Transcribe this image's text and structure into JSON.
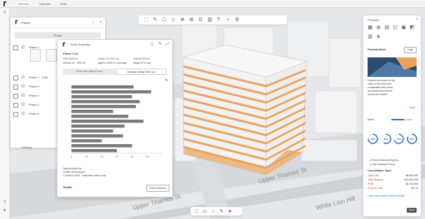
{
  "tabs": [
    {
      "label": "Overview"
    },
    {
      "label": "Calendar"
    },
    {
      "label": "Tools"
    }
  ],
  "phases_panel": {
    "title": "Phases",
    "add_button": "Phase",
    "rows": [
      {
        "label": "Phase 1"
      },
      {
        "label": "Phase 2 · 1948"
      },
      {
        "label": "Phase 3"
      },
      {
        "label": "Phase 4"
      },
      {
        "label": "Phase 5"
      },
      {
        "label": "Phase 6"
      }
    ],
    "settings_label": "Settings"
  },
  "gross_panel": {
    "title": "Gross Summary",
    "subtitle": "Phase 1 (1)",
    "stats_left": [
      "GFA 9,615 m²",
      "Storeys 10 · 83% eff"
    ],
    "stats_mid": [
      "Gross 7 m² 94.7 m²",
      "Approx 6,800 m² coverage"
    ],
    "stats_right": [
      "Volume 44.6 m³",
      "Height 32 m avg"
    ],
    "segment_left": "Gross floor area by level",
    "segment_right": "Average Selling Rate by ft",
    "bar_labels": [
      "",
      "",
      "",
      "",
      "",
      "",
      "",
      "",
      "",
      "",
      "",
      "",
      "",
      ""
    ],
    "footer_lines": [
      "Data provided by",
      "Giraffe Technologies",
      "© Autumn 2024 · Estimated values only"
    ],
    "export_label": "View Summary",
    "brand": "Giraffe"
  },
  "chart_data": {
    "type": "bar",
    "orientation": "horizontal",
    "values": [
      82,
      105,
      80,
      90,
      85,
      55,
      75,
      95,
      70,
      55,
      68,
      40,
      80,
      60
    ],
    "xlim": [
      0,
      120
    ],
    "x_ticks": [
      "0",
      "20",
      "40",
      "60",
      "80",
      "100"
    ]
  },
  "right_panel": {
    "header": "Products",
    "brand_name": "Financial Model",
    "login_label": "Login",
    "ad_lines": [
      "Explore the model for the",
      "value of this area with",
      "comparable sale prices",
      "and lease benchmarks",
      "across the market."
    ],
    "ad_link": "More",
    "metric_title": "Metric",
    "gauges": [
      "75%",
      "58%",
      "70%",
      "82%"
    ],
    "checks": [
      "Show Massing Regions",
      "Use Standard Floors"
    ],
    "summary_title": "Consolidation Types",
    "summary_rows": [
      {
        "k": "Total Cost",
        "v": "$8,500,000"
      },
      {
        "k": "Total Revenue",
        "v": "$12,640,000"
      },
      {
        "k": "Profit",
        "v": "$4,140,000"
      },
      {
        "k": "Profit on Cost",
        "v": "48.7%"
      }
    ],
    "footer_link": "Learn more about Financial Model",
    "cta": "Open"
  },
  "map_labels": {
    "road1": "Upper Thames St",
    "road2": "White Lion Hill",
    "road3": "Upper Thames St"
  },
  "colors": {
    "accent": "#1a6fc9",
    "building_orange": "#e8a25a",
    "road": "#dcdee1"
  }
}
